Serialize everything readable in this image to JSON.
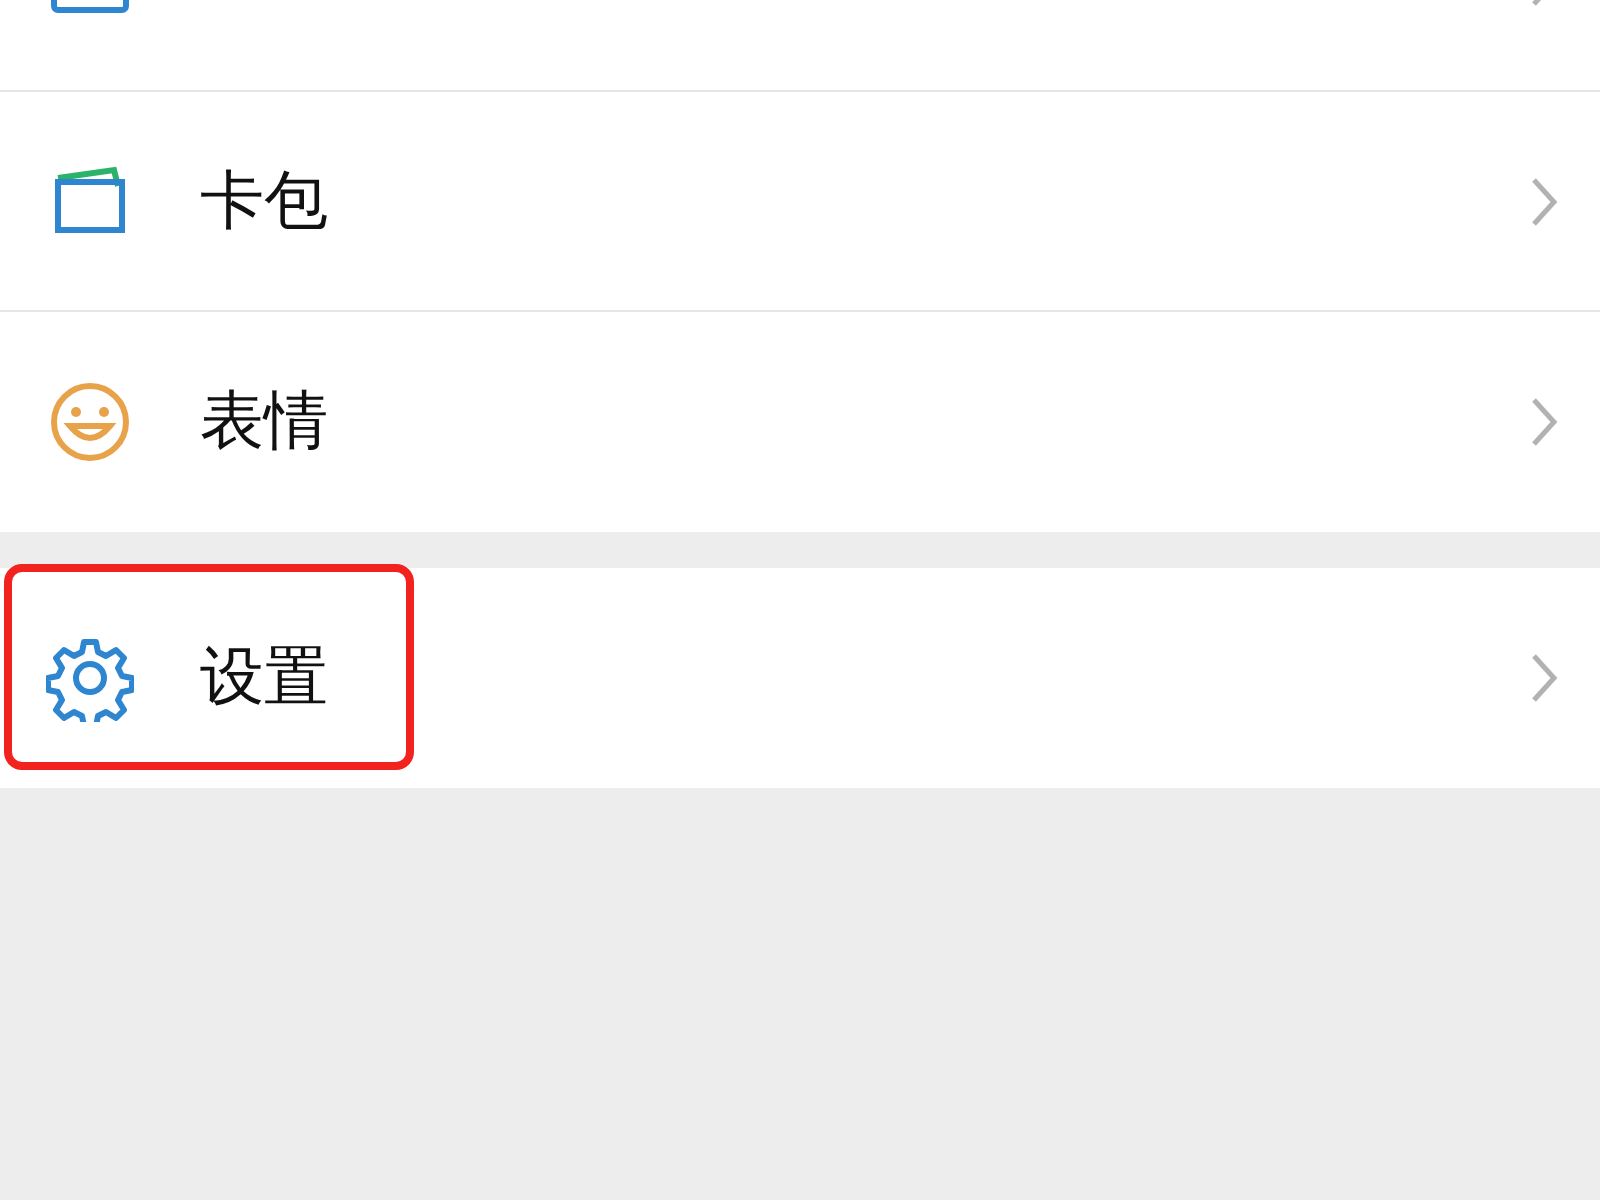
{
  "groups": [
    {
      "items": [
        {
          "kind": "moments",
          "highlighted": false
        },
        {
          "kind": "wallet",
          "label": "卡包",
          "highlighted": false
        },
        {
          "kind": "emoji",
          "label": "表情",
          "highlighted": false
        }
      ]
    },
    {
      "items": [
        {
          "kind": "settings",
          "label": "设置",
          "highlighted": true
        }
      ]
    }
  ]
}
